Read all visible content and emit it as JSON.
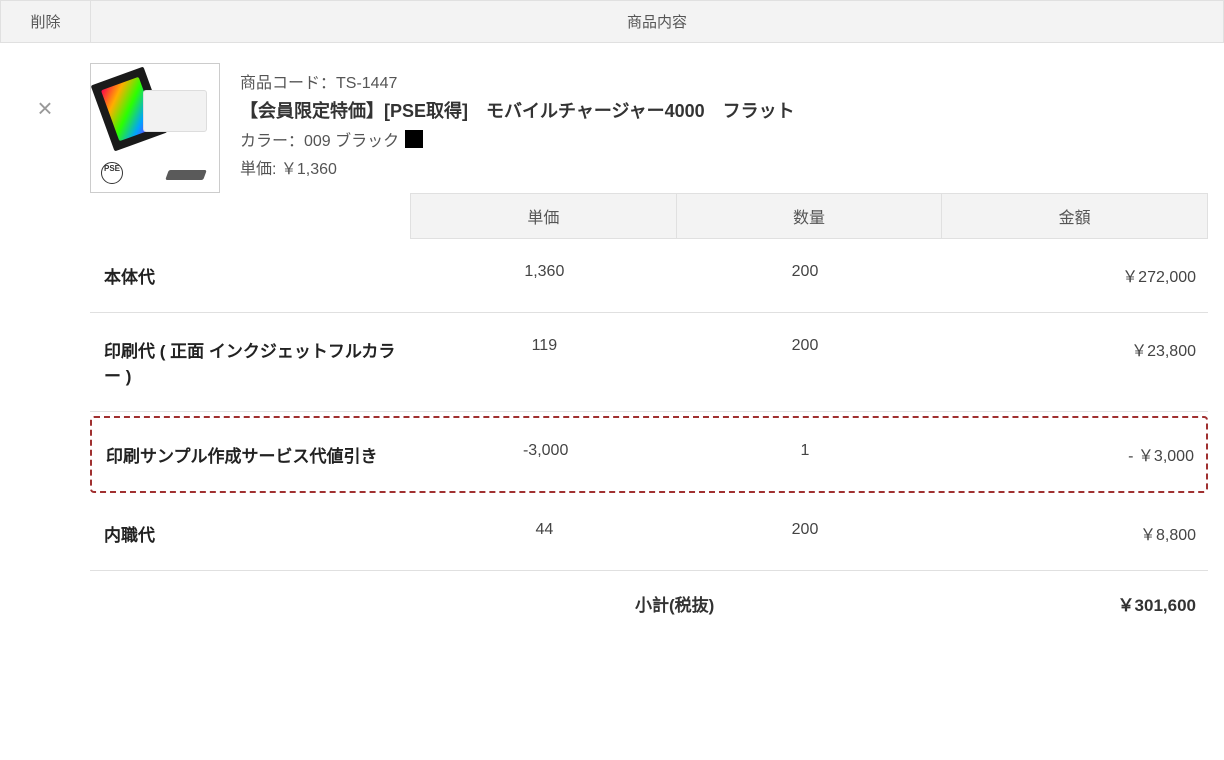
{
  "header": {
    "delete": "削除",
    "content": "商品内容"
  },
  "product": {
    "code_label": "商品コード：TS-1447",
    "name": "【会員限定特価】[PSE取得]　モバイルチャージャー4000　フラット",
    "color_label": "カラー：009 ブラック",
    "unit_price_label": "単価: ￥1,360",
    "pse_text": "PSE"
  },
  "table": {
    "headers": {
      "unit": "単価",
      "qty": "数量",
      "amount": "金額"
    },
    "rows": [
      {
        "label": "本体代",
        "unit": "1,360",
        "qty": "200",
        "amount": "￥272,000",
        "highlight": false
      },
      {
        "label": "印刷代 ( 正面 インクジェットフルカラー )",
        "unit": "119",
        "qty": "200",
        "amount": "￥23,800",
        "highlight": false
      },
      {
        "label": "印刷サンプル作成サービス代値引き",
        "unit": "-3,000",
        "qty": "1",
        "amount": "- ￥3,000",
        "highlight": true
      },
      {
        "label": "内職代",
        "unit": "44",
        "qty": "200",
        "amount": "￥8,800",
        "highlight": false
      }
    ],
    "subtotal": {
      "label": "小計(税抜)",
      "value": "￥301,600"
    }
  }
}
